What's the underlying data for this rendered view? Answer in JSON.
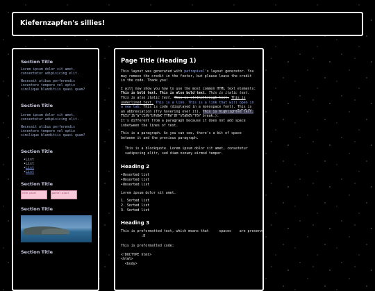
{
  "header": {
    "site_title": "Kiefernzapfen's sillies!"
  },
  "sidebar": {
    "sections": [
      {
        "title": "Section Title",
        "paragraphs": [
          "Lorem ipsum dolor sit amet, consectetur adipisicing elit.",
          "Necessit atibus perferendis inventore tempore vel optio similique blanditiis quasi quam?"
        ]
      },
      {
        "title": "Section Title",
        "paragraphs": [
          "Lorem ipsum dolor sit amet, consectetur adipisicing elit.",
          "Necessit atibus perferendis inventore tempore vel optio similique blanditiis quasi quam?"
        ]
      },
      {
        "title": "Section Title",
        "list": [
          "List",
          "List",
          "List",
          "List"
        ]
      },
      {
        "title": "Section Title",
        "buttons": [
          "cute pixel",
          "pastel pixel"
        ]
      },
      {
        "title": "Section Title"
      },
      {
        "title": "Section Title"
      }
    ]
  },
  "main": {
    "page_title": "Page Title (Heading 1)",
    "intro_1": "This layout was generated with",
    "intro_link": "petrapixel",
    "intro_2": "'s layout generator. You may remove the credit in the footer, but please leave the credit in the code. Thank you!",
    "show_1": "I will now show you how to use the most common HTML text elements:",
    "bold_1": "This is bold text.",
    "bold_2": "This is also bold text.",
    "italic_1": "This is italic text.",
    "italic_2": "This is also italic text.",
    "strike": "This is strikethrough text.",
    "underline": "This is underlined text.",
    "link_1": "This is a link.",
    "link_2": "This is a link that will open in a new tab.",
    "code": "This is code (displayed in a monospace font).",
    "abbr": "This is an abbreviation (Try hovering over it).",
    "highlight": "This is highlighted text.",
    "linebreak": "This is a line break (The br stands for break.):",
    "different": "It's different from a paragraph because it does not add space inbetween the lines of text.",
    "paragraph": "This is a paragraph. As you can see, there's a bit of space between it and the previous paragraph.",
    "blockquote": "This is a blockquote. Lorem ipsum dolor sit amet, consetetur sadipscing elitr, sed diam nonumy eirmod tempor.",
    "heading_2": "Heading 2",
    "unsorted": [
      "Unsorted list",
      "Unsorted list",
      "Unsorted list"
    ],
    "lorem": "Lorem ipsum dolor sit amet.",
    "sorted": [
      "1. Sorted list",
      "2. Sorted list",
      "3. Sorted list"
    ],
    "heading_3": "Heading 3",
    "pre_1": "This is preformatted text, which means that     spaces    are preserved.\n          :D",
    "pre_2": "This is preformatted code:",
    "code_block": "<!DOCTYPE html>\n<html>\n  <body>"
  }
}
